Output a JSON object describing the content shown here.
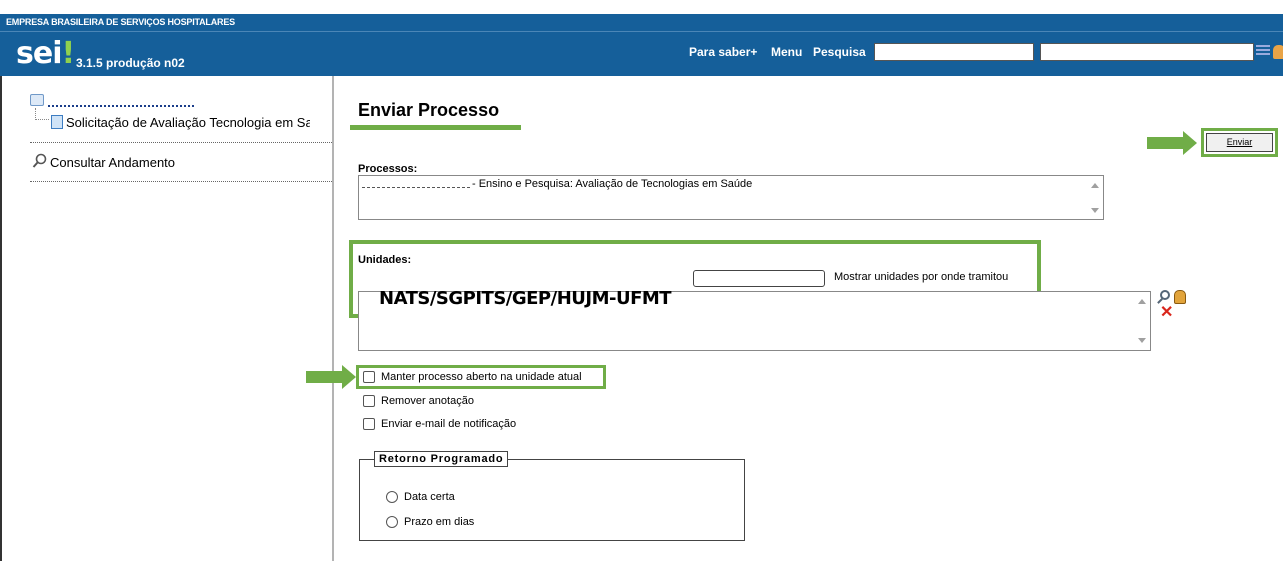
{
  "header": {
    "org_name": "EMPRESA BRASILEIRA DE SERVIÇOS HOSPITALARES",
    "logo_text": "sei",
    "logo_mark": "!",
    "version": "3.1.5 produção n02",
    "nav": {
      "saber": "Para saber+",
      "menu": "Menu",
      "pesquisa": "Pesquisa"
    },
    "search_value": "",
    "unit_select_value": "",
    "icons": [
      "grid-menu-icon",
      "user-icon"
    ]
  },
  "sidebar": {
    "process_link": "",
    "document_label": "Solicitação de Avaliação Tecnologia em Saúde",
    "consultar_label": "Consultar Andamento",
    "icons": [
      "process-icon",
      "document-icon",
      "magnifier-icon"
    ]
  },
  "main": {
    "title": "Enviar Processo",
    "enviar_label": "Enviar",
    "processos_label": "Processos:",
    "processos_value": "- Ensino e Pesquisa: Avaliação de Tecnologias em Saúde",
    "unidades_label": "Unidades:",
    "unidades_input_value": "",
    "mostrar_label": "Mostrar unidades por onde tramitou",
    "unit_code": "NATS/SGPITS/GEP/HUJM-UFMT",
    "checkboxes": {
      "manter": "Manter processo aberto na unidade atual",
      "remover": "Remover anotação",
      "email": "Enviar e-mail de notificação"
    },
    "retorno": {
      "legend": "Retorno Programado",
      "data_certa": "Data certa",
      "prazo": "Prazo em dias"
    }
  },
  "colors": {
    "header_bg": "#155f9a",
    "highlight_green": "#70ad47",
    "remove_red": "#d9261c"
  }
}
